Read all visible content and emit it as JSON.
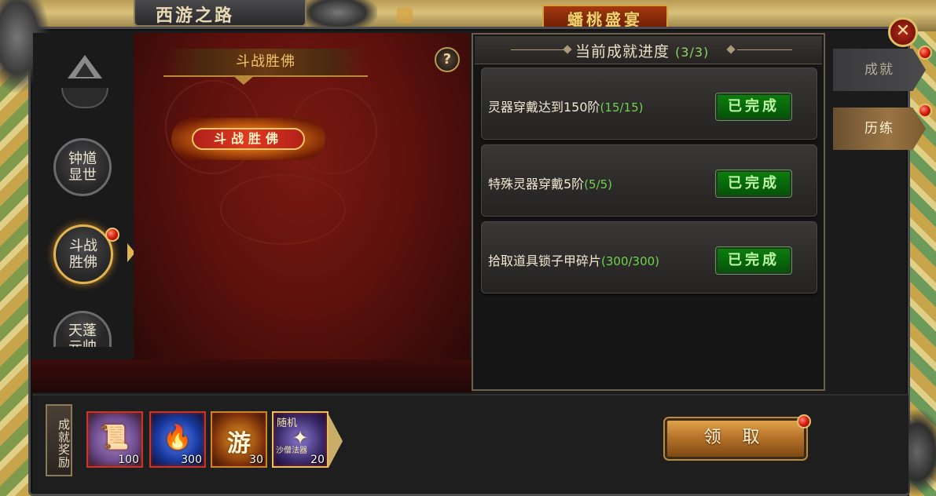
{
  "window": {
    "title": "西游之路",
    "background_banner": "蟠桃盛宴"
  },
  "colors": {
    "accent_gold": "#e3b552",
    "complete_green": "#0c7d0c",
    "progress_green": "#6fd34d",
    "red_dot": "#d21d10"
  },
  "sidebar": {
    "levels": [
      {
        "label": "钟馗\n显世",
        "active": false
      },
      {
        "label": "斗战\n胜佛",
        "active": true
      },
      {
        "label": "天蓬\n元帅",
        "active": false
      }
    ]
  },
  "center": {
    "title": "斗战胜佛",
    "badge_text": "斗战胜佛",
    "help_label": "?"
  },
  "progress": {
    "title": "当前成就进度",
    "count": "(3/3)",
    "tasks": [
      {
        "text": "灵器穿戴达到150阶",
        "progress": "(15/15)",
        "status": "已完成"
      },
      {
        "text": "特殊灵器穿戴5阶",
        "progress": "(5/5)",
        "status": "已完成"
      },
      {
        "text": "拾取道具锁子甲碎片",
        "progress": "(300/300)",
        "status": "已完成"
      }
    ]
  },
  "tabs": [
    {
      "label": "成就",
      "active": false
    },
    {
      "label": "历练",
      "active": true
    }
  ],
  "rewards": {
    "label": "成就奖励",
    "items": [
      {
        "name": "scroll-icon",
        "count": "100"
      },
      {
        "name": "blue-flame-icon",
        "count": "300"
      },
      {
        "name": "you-token-icon",
        "glyph": "游",
        "count": "30"
      },
      {
        "name": "random-weapon-icon",
        "tag": "随机",
        "sub": "沙僧法器",
        "count": "20"
      }
    ]
  },
  "claim_button": {
    "label": "领 取"
  },
  "close_label": "✕"
}
